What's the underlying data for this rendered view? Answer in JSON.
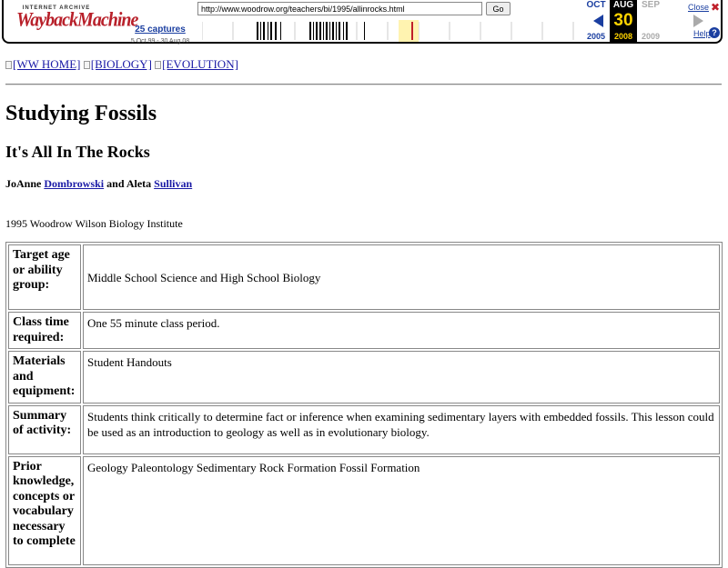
{
  "wayback": {
    "logo_top": "INTERNET ARCHIVE",
    "logo_main": "WaybackMachine",
    "url": "http://www.woodrow.org/teachers/bi/1995/allinrocks.html",
    "go_label": "Go",
    "captures_label": "25 captures",
    "captures_range": "5 Oct 99 - 30 Aug 08",
    "prev_month": "OCT",
    "prev_year": "2005",
    "cur_month": "AUG",
    "cur_day": "30",
    "cur_year": "2008",
    "next_month": "SEP",
    "next_year": "2009",
    "close_label": "Close",
    "help_label": "Help",
    "colors": {
      "accent": "#1a3ea0",
      "highlight": "#ffd400",
      "logo_red": "#b8202a"
    }
  },
  "nav": {
    "items": [
      {
        "label": "[WW HOME]"
      },
      {
        "label": "[BIOLOGY]"
      },
      {
        "label": "[EVOLUTION]"
      }
    ]
  },
  "page": {
    "title": "Studying Fossils",
    "subtitle": "It's All In The Rocks",
    "author1_first": "JoAnne",
    "author1_last": "Dombrowski",
    "and_text": "and Aleta",
    "author2_last": "Sullivan",
    "institute": "1995 Woodrow Wilson Biology Institute"
  },
  "table": {
    "rows": [
      {
        "label": "Target age or ability group:",
        "value": "Middle School Science and High School Biology"
      },
      {
        "label": "Class time required:",
        "value": "One 55 minute class period."
      },
      {
        "label": "Materials and equipment:",
        "value": "Student Handouts"
      },
      {
        "label": "Summary of activity:",
        "value": "Students think critically to determine fact or inference when examining sedimentary layers with embedded fossils. This lesson could be used as an introduction to geology as well as in evolutionary biology."
      },
      {
        "label": "Prior knowledge, concepts or vocabulary necessary to complete",
        "value": "Geology Paleontology Sedimentary Rock Formation Fossil Formation"
      }
    ]
  }
}
